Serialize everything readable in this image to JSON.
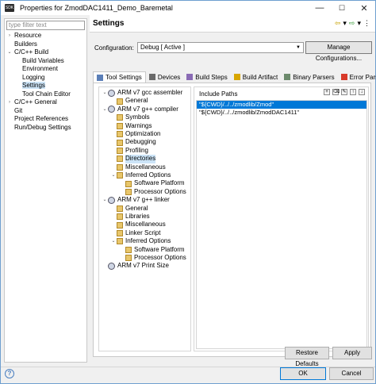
{
  "window": {
    "app_icon": "SDK",
    "title": "Properties for ZmodDAC1411_Demo_Baremetal",
    "controls": [
      "—",
      "☐",
      "✕"
    ]
  },
  "sidebar": {
    "filter_placeholder": "type filter text",
    "items": [
      {
        "label": "Resource",
        "expander": "›",
        "indent": 0
      },
      {
        "label": "Builders",
        "expander": "",
        "indent": 0
      },
      {
        "label": "C/C++ Build",
        "expander": "⌄",
        "indent": 0
      },
      {
        "label": "Build Variables",
        "expander": "",
        "indent": 1
      },
      {
        "label": "Environment",
        "expander": "",
        "indent": 1
      },
      {
        "label": "Logging",
        "expander": "",
        "indent": 1
      },
      {
        "label": "Settings",
        "expander": "",
        "indent": 1,
        "selected": true
      },
      {
        "label": "Tool Chain Editor",
        "expander": "",
        "indent": 1
      },
      {
        "label": "C/C++ General",
        "expander": "›",
        "indent": 0
      },
      {
        "label": "Git",
        "expander": "",
        "indent": 0
      },
      {
        "label": "Project References",
        "expander": "",
        "indent": 0
      },
      {
        "label": "Run/Debug Settings",
        "expander": "",
        "indent": 0
      }
    ]
  },
  "header": {
    "title": "Settings",
    "nav": [
      "⇦",
      "▾",
      "⇨",
      "▾",
      "⋮"
    ]
  },
  "configuration": {
    "label": "Configuration:",
    "value": "Debug  [ Active ]",
    "manage_button": "Manage Configurations..."
  },
  "tabs": [
    {
      "label": "Tool Settings",
      "active": true,
      "icon_color": "#5b7fb8"
    },
    {
      "label": "Devices",
      "icon_color": "#6a6a6a"
    },
    {
      "label": "Build Steps",
      "icon_color": "#8a6bb5"
    },
    {
      "label": "Build Artifact",
      "icon_color": "#d8a600"
    },
    {
      "label": "Binary Parsers",
      "icon_color": "#6c8a6c"
    },
    {
      "label": "Error Parsers",
      "icon_color": "#d83a2a"
    }
  ],
  "tool_tree": [
    {
      "label": "ARM v7 gcc assembler",
      "level": 0,
      "type": "tool",
      "exp": "⌄"
    },
    {
      "label": "General",
      "level": 1,
      "type": "folder"
    },
    {
      "label": "ARM v7 g++ compiler",
      "level": 0,
      "type": "tool",
      "exp": "⌄"
    },
    {
      "label": "Symbols",
      "level": 1,
      "type": "folder"
    },
    {
      "label": "Warnings",
      "level": 1,
      "type": "folder"
    },
    {
      "label": "Optimization",
      "level": 1,
      "type": "folder"
    },
    {
      "label": "Debugging",
      "level": 1,
      "type": "folder"
    },
    {
      "label": "Profiling",
      "level": 1,
      "type": "folder"
    },
    {
      "label": "Directories",
      "level": 1,
      "type": "folder",
      "selected": true
    },
    {
      "label": "Miscellaneous",
      "level": 1,
      "type": "folder"
    },
    {
      "label": "Inferred Options",
      "level": 1,
      "type": "folder",
      "exp": "⌄"
    },
    {
      "label": "Software Platform",
      "level": 2,
      "type": "folder"
    },
    {
      "label": "Processor Options",
      "level": 2,
      "type": "folder"
    },
    {
      "label": "ARM v7 g++ linker",
      "level": 0,
      "type": "tool",
      "exp": "⌄"
    },
    {
      "label": "General",
      "level": 1,
      "type": "folder"
    },
    {
      "label": "Libraries",
      "level": 1,
      "type": "folder"
    },
    {
      "label": "Miscellaneous",
      "level": 1,
      "type": "folder"
    },
    {
      "label": "Linker Script",
      "level": 1,
      "type": "folder"
    },
    {
      "label": "Inferred Options",
      "level": 1,
      "type": "folder",
      "exp": "⌄"
    },
    {
      "label": "Software Platform",
      "level": 2,
      "type": "folder"
    },
    {
      "label": "Processor Options",
      "level": 2,
      "type": "folder"
    },
    {
      "label": "ARM v7 Print Size",
      "level": 0,
      "type": "tool"
    }
  ],
  "include_paths": {
    "title": "Include Paths",
    "toolbar": [
      "+",
      "⌫",
      "✎",
      "↑",
      "↓"
    ],
    "items": [
      {
        "value": "\"${CWD}/../../zmodlib/Zmod\"",
        "selected": true
      },
      {
        "value": "\"${CWD}/../../zmodlib/ZmodDAC1411\""
      }
    ]
  },
  "buttons": {
    "restore_defaults": "Restore Defaults",
    "apply": "Apply",
    "ok": "OK",
    "cancel": "Cancel",
    "help": "?"
  }
}
